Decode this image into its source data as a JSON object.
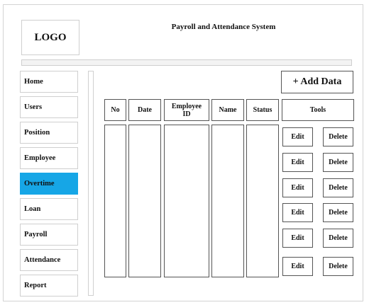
{
  "header": {
    "logo_text": "LOGO",
    "app_title": "Payroll and Attendance System"
  },
  "sidebar": {
    "items": [
      {
        "label": "Home"
      },
      {
        "label": "Users"
      },
      {
        "label": "Position"
      },
      {
        "label": "Employee"
      },
      {
        "label": "Overtime",
        "active": true
      },
      {
        "label": "Loan"
      },
      {
        "label": "Payroll"
      },
      {
        "label": "Attendance"
      },
      {
        "label": "Report"
      }
    ]
  },
  "toolbar": {
    "add_label": "+ Add Data"
  },
  "table": {
    "columns": [
      "No",
      "Date",
      "Employee ID",
      "Name",
      "Status",
      "Tools"
    ],
    "row_actions": [
      {
        "edit": "Edit",
        "delete": "Delete"
      },
      {
        "edit": "Edit",
        "delete": "Delete"
      },
      {
        "edit": "Edit",
        "delete": "Delete"
      },
      {
        "edit": "Edit",
        "delete": "Delete"
      },
      {
        "edit": "Edit",
        "delete": "Delete"
      },
      {
        "edit": "Edit",
        "delete": "Delete"
      }
    ]
  },
  "colors": {
    "active_nav": "#16a6e6"
  }
}
